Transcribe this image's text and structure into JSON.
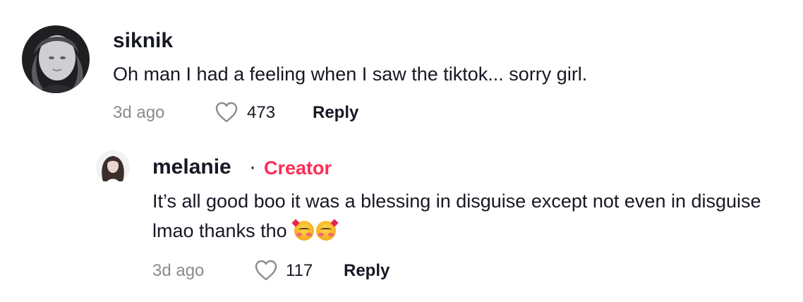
{
  "comment": {
    "username": "siknik",
    "text": "Oh man I had a feeling when I saw the tiktok... sorry girl.",
    "time": "3d ago",
    "likes": "473",
    "reply_label": "Reply",
    "avatar_icon": "user-avatar-icon"
  },
  "reply": {
    "username": "melanie",
    "separator": "·",
    "badge": "Creator",
    "badge_color": "#fe2c55",
    "text": "It’s all good boo it was a blessing in disguise except not even in disguise lmao thanks tho",
    "emoji": [
      "smiling-face-with-hearts",
      "smiling-face-with-hearts"
    ],
    "time": "3d ago",
    "likes": "117",
    "reply_label": "Reply",
    "avatar_icon": "user-avatar-icon"
  }
}
